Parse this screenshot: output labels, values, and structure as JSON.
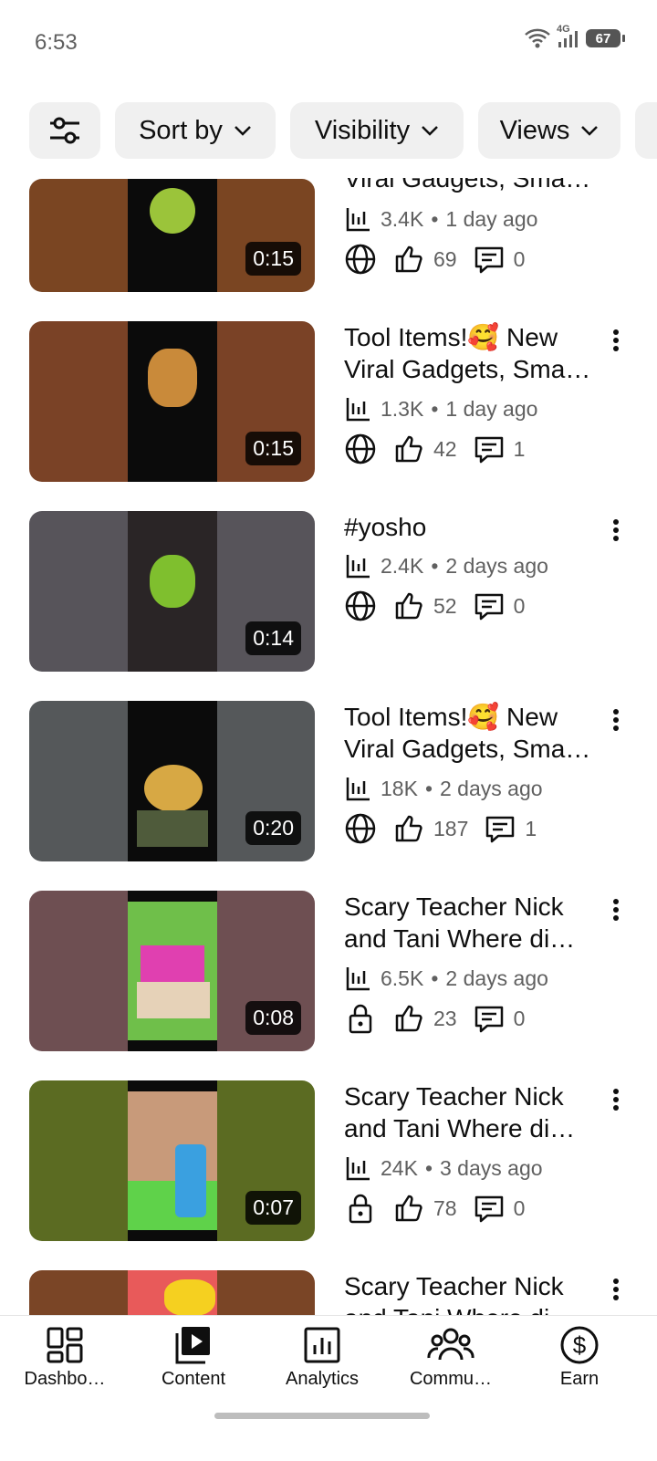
{
  "status": {
    "time": "6:53",
    "network": "4G",
    "battery": "67"
  },
  "filters": {
    "sort_label": "Sort by",
    "visibility_label": "Visibility",
    "views_label": "Views"
  },
  "videos": [
    {
      "title1": "Viral Gadgets, Sma…",
      "title2": "",
      "views": "3.4K",
      "age": "1 day ago",
      "likes": "69",
      "comments": "0",
      "duration": "0:15",
      "visibility_icon": "globe-icon",
      "thumb_color": "#7a4522"
    },
    {
      "title1": "Tool Items!🥰 New",
      "title2": "Viral Gadgets, Sma…",
      "views": "1.3K",
      "age": "1 day ago",
      "likes": "42",
      "comments": "1",
      "duration": "0:15",
      "visibility_icon": "globe-icon",
      "thumb_color": "#7a4226"
    },
    {
      "title1": "#yosho",
      "title2": "",
      "views": "2.4K",
      "age": "2 days ago",
      "likes": "52",
      "comments": "0",
      "duration": "0:14",
      "visibility_icon": "globe-icon",
      "thumb_color": "#57545a"
    },
    {
      "title1": "Tool Items!🥰 New",
      "title2": "Viral Gadgets, Sma…",
      "views": "18K",
      "age": "2 days ago",
      "likes": "187",
      "comments": "1",
      "duration": "0:20",
      "visibility_icon": "globe-icon",
      "thumb_color": "#55585a"
    },
    {
      "title1": "Scary Teacher Nick",
      "title2": "and Tani Where di…",
      "views": "6.5K",
      "age": "2 days ago",
      "likes": "23",
      "comments": "0",
      "duration": "0:08",
      "visibility_icon": "lock-icon",
      "thumb_color": "#6e4f52"
    },
    {
      "title1": "Scary Teacher Nick",
      "title2": "and Tani Where di…",
      "views": "24K",
      "age": "3 days ago",
      "likes": "78",
      "comments": "0",
      "duration": "0:07",
      "visibility_icon": "lock-icon",
      "thumb_color": "#5b6b22"
    },
    {
      "title1": "Scary Teacher Nick",
      "title2": "and Tani Where di…",
      "views": "",
      "age": "",
      "likes": "",
      "comments": "",
      "duration": "",
      "visibility_icon": "",
      "thumb_color": "#7a4526"
    }
  ],
  "nav": {
    "dashboard": "Dashbo…",
    "content": "Content",
    "analytics": "Analytics",
    "community": "Commu…",
    "earn": "Earn"
  }
}
